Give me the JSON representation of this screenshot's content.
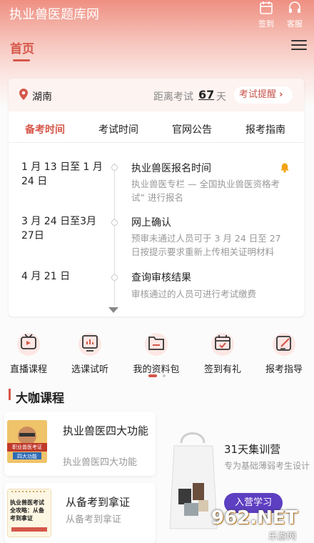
{
  "colors": {
    "accent": "#d5574a",
    "header": "#ef8f82",
    "promo_button": "#5d3fc2"
  },
  "header": {
    "title": "执业兽医题库网",
    "checkin_label": "签到",
    "service_label": "客服",
    "home_tab": "首页"
  },
  "exam_card": {
    "location": "湖南",
    "countdown_label": "距离考试",
    "days": "67",
    "days_unit": "天",
    "reminder_label": "考试提醒",
    "tabs": [
      "备考时间",
      "考试时间",
      "官网公告",
      "报考指南"
    ],
    "timeline": [
      {
        "date": "1 月 13 日至 1 月 24 日",
        "title": "执业兽医报名时间",
        "desc": "执业兽医专栏 — 全国执业兽医资格考试” 进行报名"
      },
      {
        "date": "3 月 24 日至3月27日",
        "title": "网上确认",
        "desc": "预审未通过人员可于 3 月 24 日至 27 日按提示要求重新上传相关证明材料"
      },
      {
        "date": "4 月 21 日",
        "title": "查询审核结果",
        "desc": "审核通过的人员可进行考试缴费"
      }
    ]
  },
  "quick_actions": [
    {
      "label": "直播课程",
      "icon": "tv-icon"
    },
    {
      "label": "选课试听",
      "icon": "chart-screen-icon"
    },
    {
      "label": "我的资料包",
      "icon": "folder-icon"
    },
    {
      "label": "签到有礼",
      "icon": "calendar-check-icon"
    },
    {
      "label": "报考指导",
      "icon": "pen-doc-icon"
    }
  ],
  "section_title": "大咖课程",
  "courses": [
    {
      "title": "执业兽医四大功能",
      "subtitle": "执业兽医四大功能",
      "thumb_text": "职业兽医考证",
      "thumb_badge": "四大功能"
    },
    {
      "title": "从备考到拿证",
      "subtitle": "从备考到拿证",
      "thumb_text": "执业兽医考试全攻略：从备考到拿证"
    }
  ],
  "promo": {
    "title": "31天集训营",
    "subtitle": "专为基础薄弱考生设计",
    "button": "入营学习"
  },
  "watermark": {
    "main": "962.NET",
    "sub": "乐游网"
  }
}
